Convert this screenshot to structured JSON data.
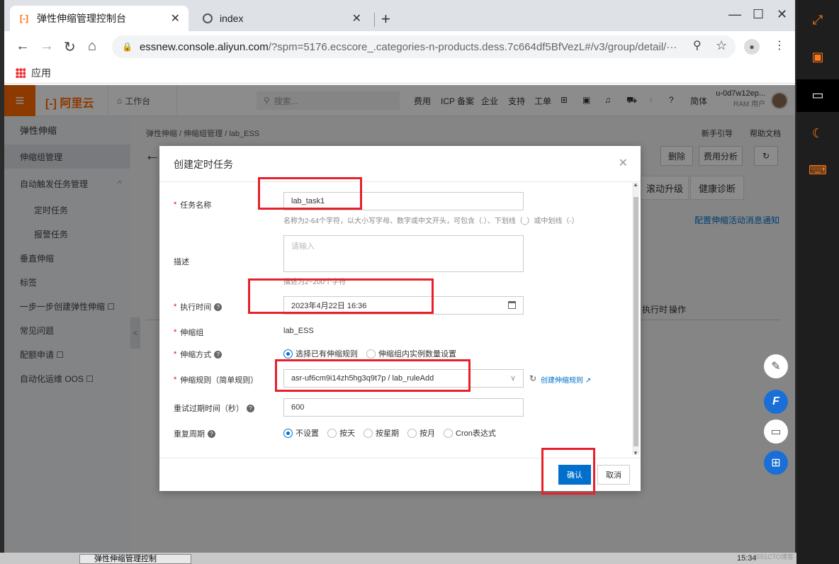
{
  "browser": {
    "tabs": [
      {
        "title": "弹性伸缩管理控制台",
        "icon": "aliyun-icon",
        "active": true
      },
      {
        "title": "index",
        "icon": "globe-icon",
        "active": false
      }
    ],
    "new_tab": "+",
    "url_main": "essnew.console.aliyun.com",
    "url_rest": "/?spm=5176.ecscore_.categories-n-products.dess.7c664df5BfVezL#/v3/group/detail/···",
    "bookmarks_label": "应用"
  },
  "topnav": {
    "logo": "阿里云",
    "workbench": "工作台",
    "search_placeholder": "搜索...",
    "items": [
      "费用",
      "ICP 备案",
      "企业",
      "支持",
      "工单"
    ],
    "lang": "简体",
    "user": "u-0d7w12ep...",
    "user_sub": "RAM 用户"
  },
  "sidebar": {
    "title": "弹性伸缩",
    "items": [
      {
        "label": "伸缩组管理",
        "sub": false,
        "active": true
      },
      {
        "label": "自动触发任务管理",
        "sub": false,
        "active": false
      },
      {
        "label": "定时任务",
        "sub": true,
        "active": false
      },
      {
        "label": "报警任务",
        "sub": true,
        "active": false
      },
      {
        "label": "垂直伸缩",
        "sub": false,
        "active": false
      },
      {
        "label": "标签",
        "sub": false,
        "active": false
      },
      {
        "label": "一步一步创建弹性伸缩 ☐",
        "sub": false,
        "active": false
      },
      {
        "label": "常见问题",
        "sub": false,
        "active": false
      },
      {
        "label": "配额申请 ☐",
        "sub": false,
        "active": false
      },
      {
        "label": "自动化运维 OOS ☐",
        "sub": false,
        "active": false
      }
    ]
  },
  "page": {
    "breadcrumb": "弹性伸缩 / 伸缩组管理 / lab_ESS",
    "guide": "新手引导",
    "help_doc": "帮助文档",
    "actions": [
      "删除",
      "费用分析"
    ],
    "tabs": [
      "滚动升级",
      "健康诊断"
    ],
    "notify_link": "配置伸缩活动消息通知",
    "table_cols": [
      "执行时",
      "操作"
    ]
  },
  "modal": {
    "title": "创建定时任务",
    "fields": {
      "name_label": "任务名称",
      "name_value": "lab_task1",
      "name_hint": "名称为2-64个字符，以大小写字母、数字或中文开头，可包含（.）、下划线（_）或中划线（-）",
      "desc_label": "描述",
      "desc_placeholder": "请输入",
      "desc_hint": "描述为2~200个字符",
      "time_label": "执行时间",
      "time_value": "2023年4月22日 16:36",
      "group_label": "伸缩组",
      "group_value": "lab_ESS",
      "mode_label": "伸缩方式",
      "mode_opt1": "选择已有伸缩规则",
      "mode_opt2": "伸缩组内实例数量设置",
      "rule_label": "伸缩规则（简单规则）",
      "rule_value": "asr-uf6cm9i14zh5hg3q9t7p / lab_ruleAdd",
      "create_rule": "创建伸缩规则",
      "retry_label": "重试过期时间（秒）",
      "retry_value": "600",
      "repeat_label": "重复周期",
      "repeat_opts": [
        "不设置",
        "按天",
        "按星期",
        "按月",
        "Cron表达式"
      ]
    },
    "ok": "确认",
    "cancel": "取消"
  },
  "taskbar": {
    "app": "弹性伸缩管理控制",
    "time": "15:34",
    "watermark": "©51CTO博客"
  },
  "colors": {
    "accent": "#ff6a00",
    "primary": "#0070cc",
    "highlight": "#e8202a"
  }
}
